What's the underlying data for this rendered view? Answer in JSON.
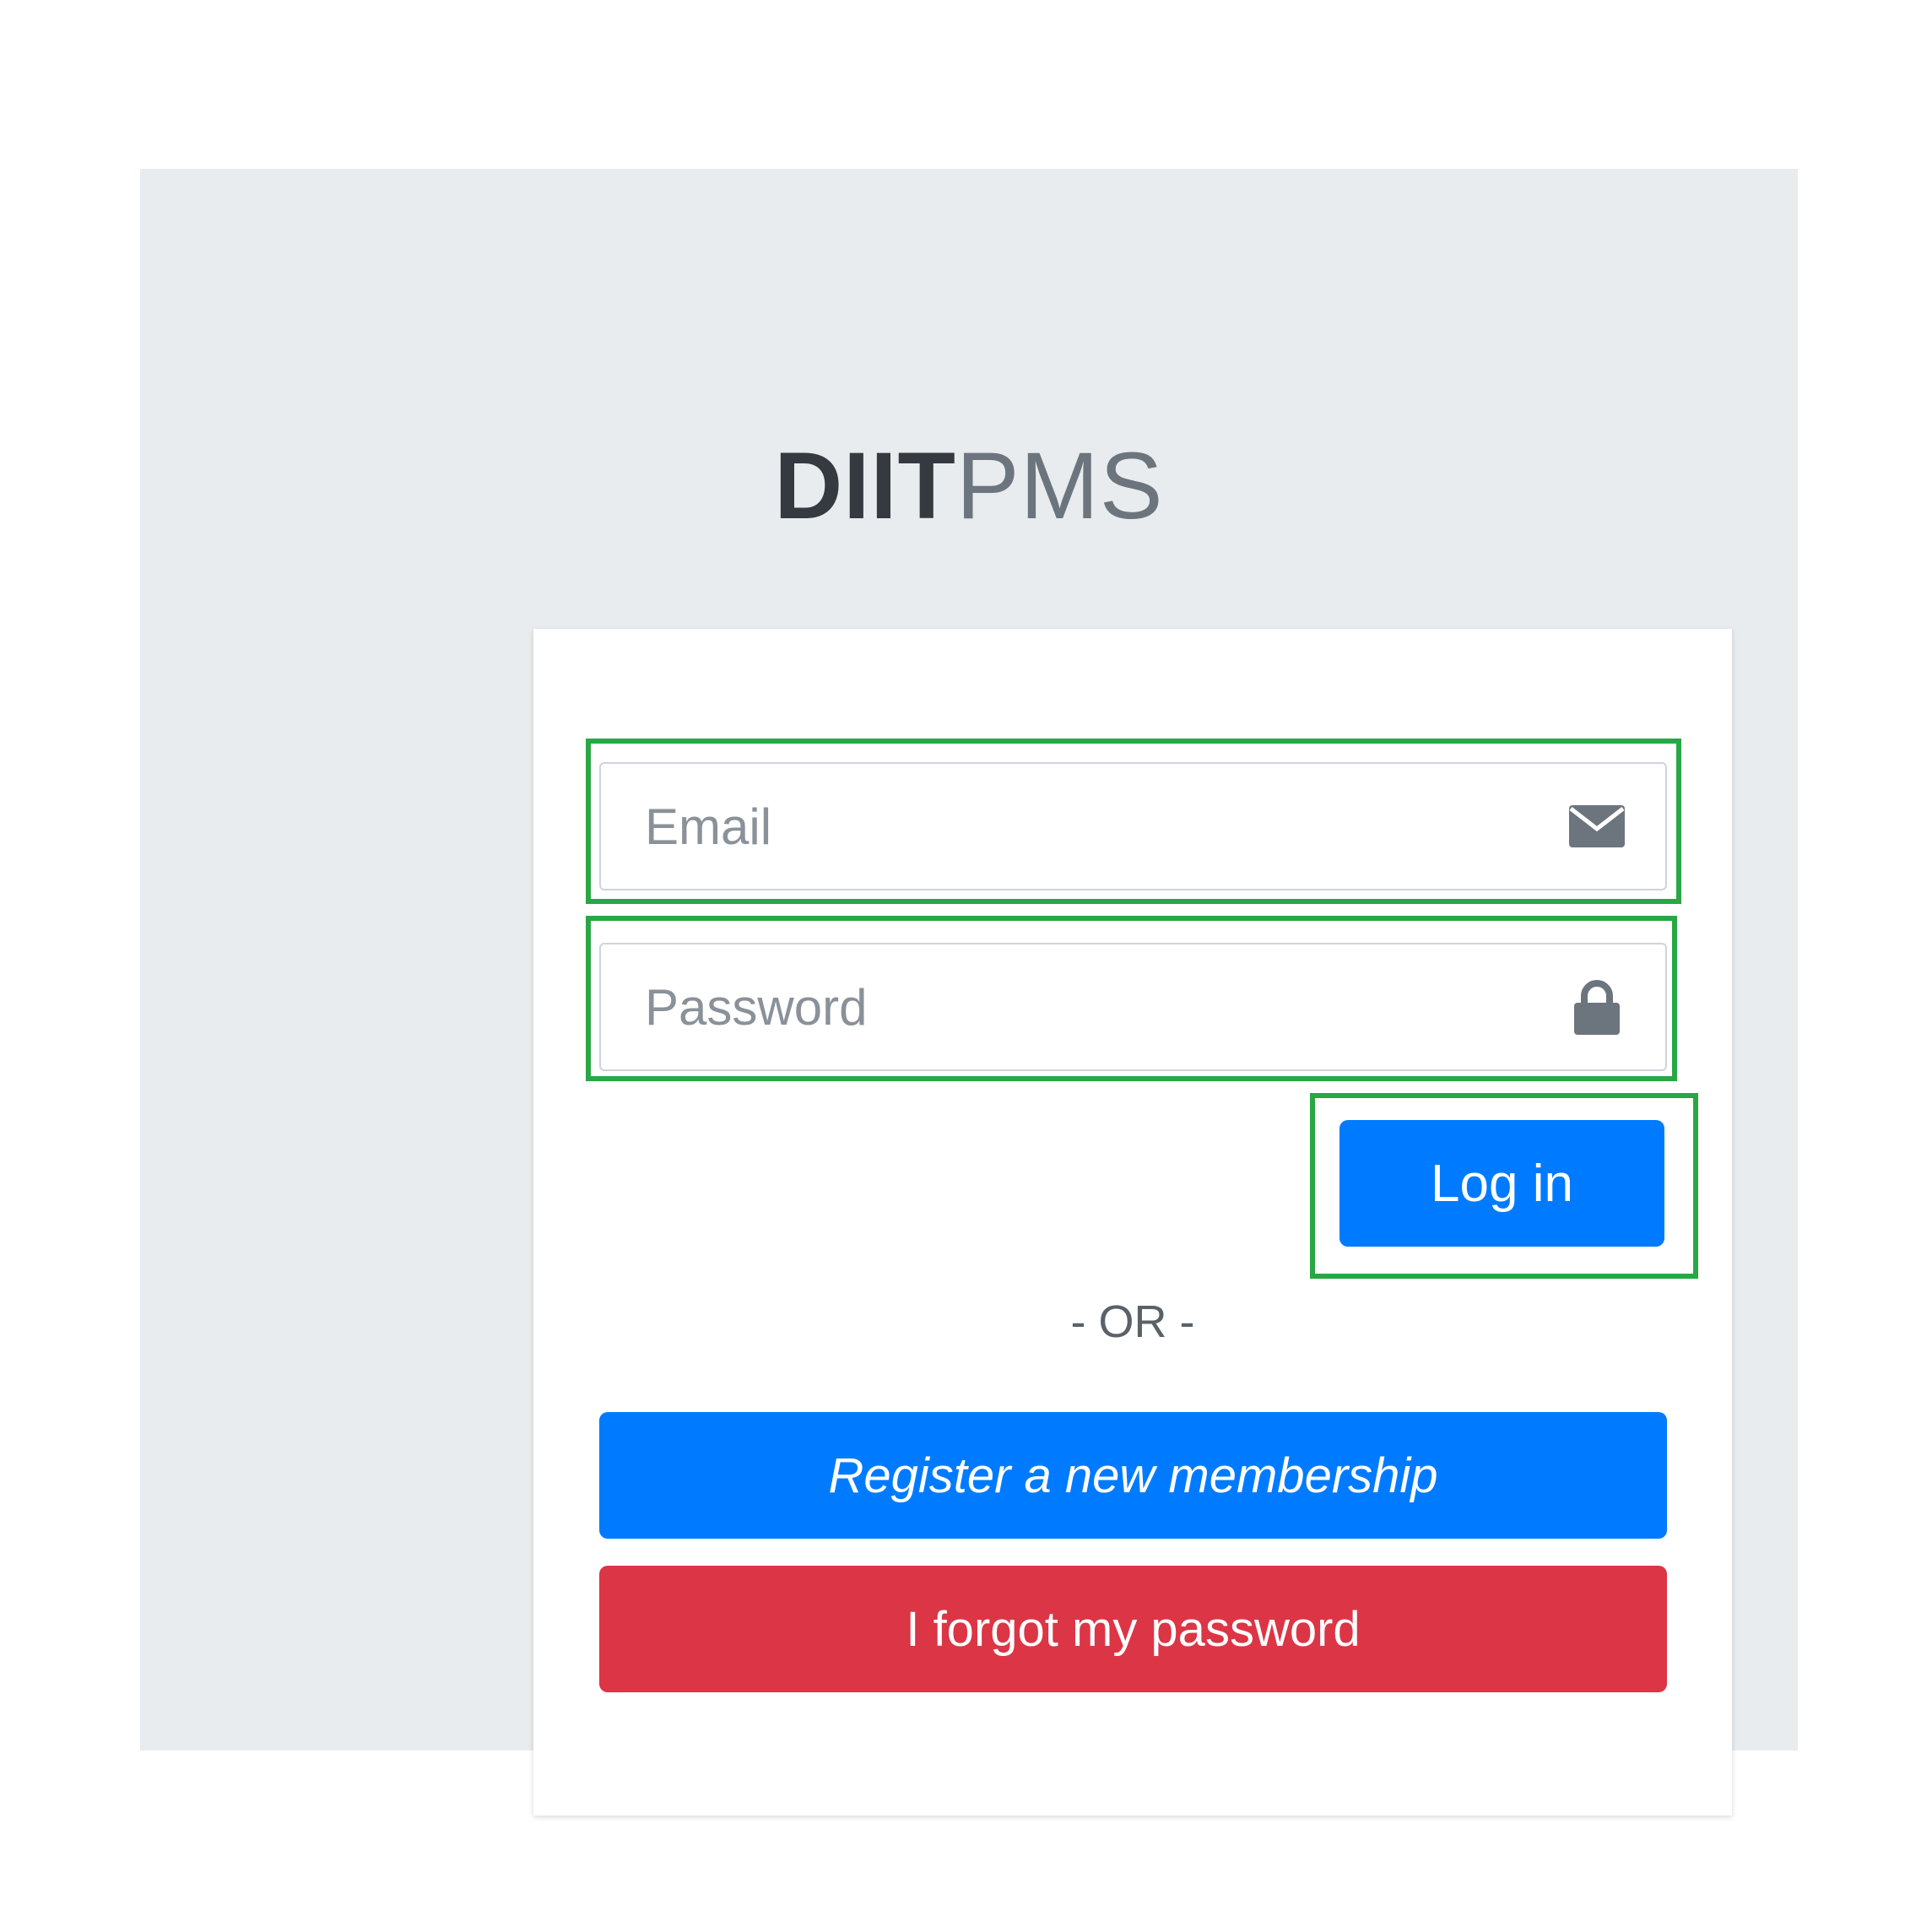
{
  "app": {
    "logo_bold": "DIIT",
    "logo_light": "PMS"
  },
  "login_form": {
    "email": {
      "placeholder": "Email",
      "value": "",
      "icon": "envelope-icon"
    },
    "password": {
      "placeholder": "Password",
      "value": "",
      "icon": "lock-icon"
    },
    "login_label": "Log in",
    "divider_text": "- OR -",
    "register_label": "Register a new membership",
    "forgot_label": "I forgot my password"
  },
  "colors": {
    "primary": "#007bff",
    "danger": "#dc3545",
    "highlight": "#28a745",
    "page_bg": "#e9ecef"
  }
}
